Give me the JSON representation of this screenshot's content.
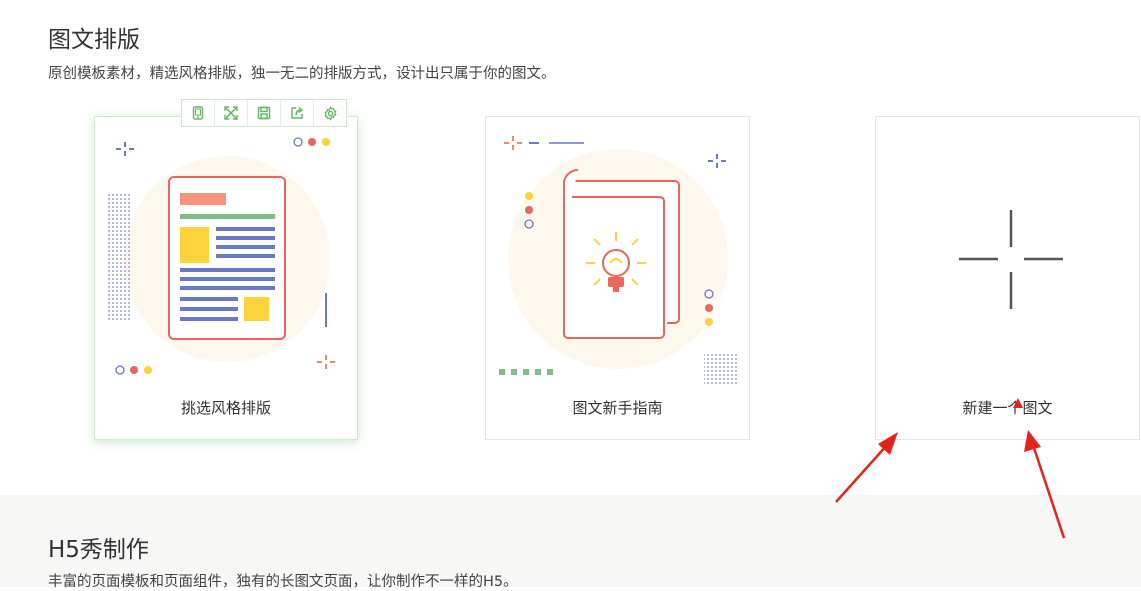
{
  "section1": {
    "title": "图文排版",
    "desc": "原创模板素材，精选风格排版，独一无二的排版方式，设计出只属于你的图文。"
  },
  "cards": [
    {
      "label": "挑选风格排版"
    },
    {
      "label": "图文新手指南"
    },
    {
      "label": "新建一个图文"
    }
  ],
  "toolbar": {
    "icons": [
      "phone-preview-icon",
      "fullscreen-icon",
      "save-icon",
      "share-icon",
      "settings-icon"
    ]
  },
  "section2": {
    "title": "H5秀制作",
    "desc": "丰富的页面模板和页面组件，独有的长图文页面，让你制作不一样的H5。"
  },
  "colors": {
    "accent_green": "#5cb85c",
    "art_red": "#e8665c",
    "art_yellow": "#fcd33a",
    "art_blue": "#6b78c4",
    "arrow_red": "#e5221b",
    "bottom_bg": "#f7f7f6"
  }
}
